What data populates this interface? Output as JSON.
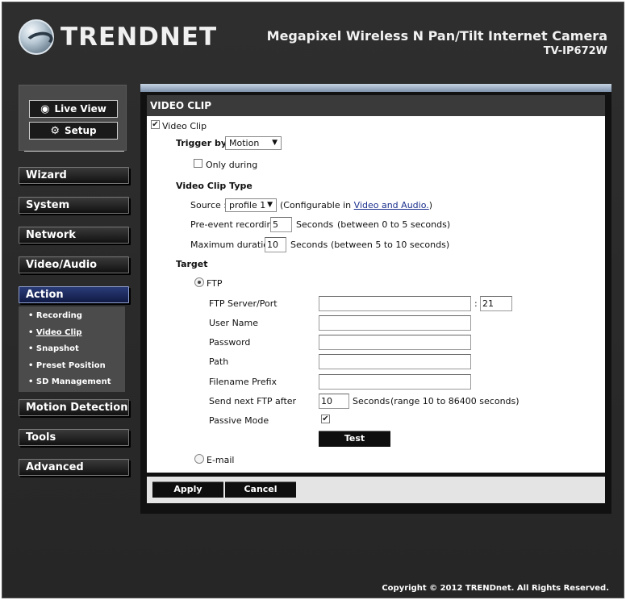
{
  "brand": {
    "logo_text": "TRENDNET"
  },
  "product": {
    "title": "Megapixel Wireless N Pan/Tilt Internet Camera",
    "model": "TV-IP672W"
  },
  "mode_buttons": {
    "live_view": "Live View",
    "setup": "Setup"
  },
  "nav": {
    "wizard": "Wizard",
    "system": "System",
    "network": "Network",
    "video_audio": "Video/Audio",
    "action": "Action",
    "motion_detection": "Motion Detection",
    "tools": "Tools",
    "advanced": "Advanced"
  },
  "subnav": [
    "Recording",
    "Video Clip",
    "Snapshot",
    "Preset Position",
    "SD Management"
  ],
  "panel": {
    "title": "VIDEO CLIP",
    "video_clip_label": "Video Clip",
    "video_clip_checked": true,
    "trigger_by_label": "Trigger by",
    "trigger_by_value": "Motion",
    "only_during_label": "Only during",
    "only_during_checked": false,
    "clip_type_label": "Video Clip Type",
    "source_label": "Source :",
    "source_value": "profile 1",
    "source_note_prefix": "(Configurable in ",
    "source_note_link": "Video and Audio.",
    "source_note_suffix": ")",
    "pre_event_label": "Pre-event recording",
    "pre_event_value": "5",
    "pre_event_unit": "Seconds",
    "pre_event_range": "(between 0 to 5 seconds)",
    "max_duration_label": "Maximum duration",
    "max_duration_value": "10",
    "max_duration_unit": "Seconds",
    "max_duration_range": "(between 5 to 10 seconds)",
    "target_label": "Target",
    "ftp_label": "FTP",
    "ftp_selected": true,
    "ftp_server_label": "FTP Server/Port",
    "ftp_server_value": "",
    "port_separator": ":",
    "ftp_port_value": "21",
    "user_name_label": "User Name",
    "user_name_value": "",
    "password_label": "Password",
    "password_value": "",
    "path_label": "Path",
    "path_value": "",
    "filename_prefix_label": "Filename Prefix",
    "filename_prefix_value": "",
    "send_next_label": "Send next FTP after",
    "send_next_value": "10",
    "send_next_unit": "Seconds",
    "send_next_range": "(range 10 to 86400 seconds)",
    "passive_mode_label": "Passive Mode",
    "passive_mode_checked": true,
    "test_button": "Test",
    "email_label": "E-mail"
  },
  "footer_buttons": {
    "apply": "Apply",
    "cancel": "Cancel"
  },
  "copyright": "Copyright © 2012 TRENDnet. All Rights Reserved."
}
